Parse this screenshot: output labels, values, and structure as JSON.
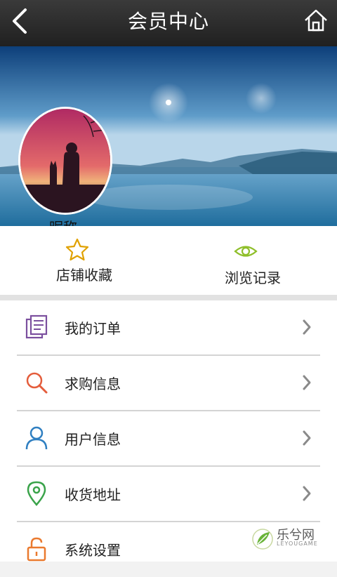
{
  "header": {
    "title": "会员中心"
  },
  "profile": {
    "nickname": "昵称"
  },
  "quick_actions": [
    {
      "label": "店铺收藏",
      "icon": "star-icon",
      "color": "#e0a100"
    },
    {
      "label": "浏览记录",
      "icon": "eye-icon",
      "color": "#8fbf2a"
    }
  ],
  "menu": [
    {
      "label": "我的订单",
      "icon": "order-document-icon",
      "color": "#7b4f9e"
    },
    {
      "label": "求购信息",
      "icon": "search-icon",
      "color": "#e45d3c"
    },
    {
      "label": "用户信息",
      "icon": "user-icon",
      "color": "#2f7fc1"
    },
    {
      "label": "收货地址",
      "icon": "location-pin-icon",
      "color": "#3aa34a"
    },
    {
      "label": "系统设置",
      "icon": "lock-icon",
      "color": "#ea7a2f"
    }
  ],
  "watermark": {
    "text": "乐兮网",
    "sub": "LEYOUGAME"
  }
}
